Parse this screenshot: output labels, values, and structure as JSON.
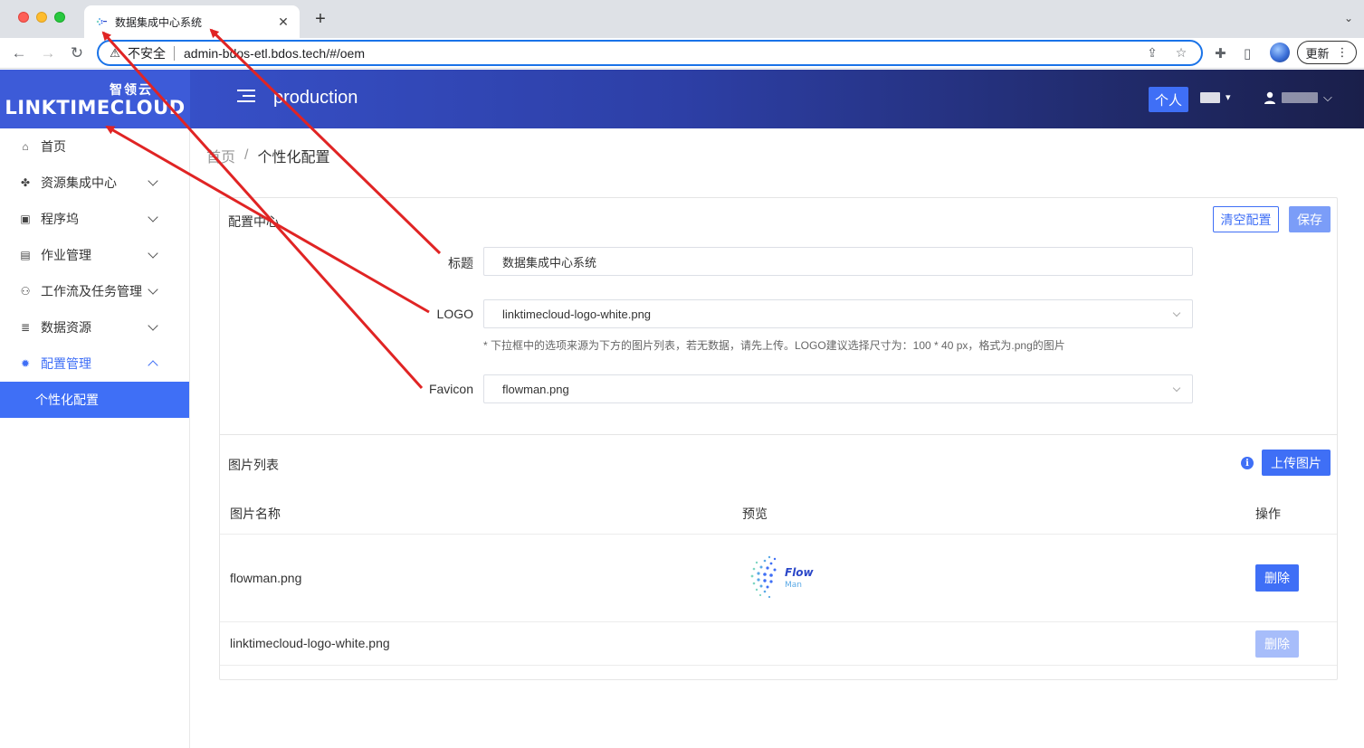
{
  "browser": {
    "tab_title": "数据集成中心系统",
    "tab_close": "✕",
    "new_tab": "+",
    "tab_menu": "⌄",
    "insecure_label": "不安全",
    "url": "admin-bdos-etl.bdos.tech/#/oem",
    "update_label": "更新",
    "update_menu": "⋮",
    "back": "←",
    "forward": "→",
    "reload": "↻",
    "warning": "⚠",
    "share": "⇪",
    "bookmark": "☆",
    "extensions": "✚",
    "sidepanel": "▯"
  },
  "header": {
    "logo_cn": "智领云",
    "logo_en": "LINKTIMECLOUD",
    "env_name": "production",
    "personal_label": "个人",
    "caret": "▾",
    "user_caret": "⌵",
    "user_icon": "👤"
  },
  "sidebar": {
    "items": [
      {
        "label": "首页",
        "icon": "⌂"
      },
      {
        "label": "资源集成中心",
        "icon": "✤"
      },
      {
        "label": "程序坞",
        "icon": "▣"
      },
      {
        "label": "作业管理",
        "icon": "▤"
      },
      {
        "label": "工作流及任务管理",
        "icon": "⚇"
      },
      {
        "label": "数据资源",
        "icon": "≣"
      },
      {
        "label": "配置管理",
        "icon": "✹"
      }
    ],
    "sub_active": "个性化配置"
  },
  "breadcrumb": {
    "home": "首页",
    "sep": "/",
    "current": "个性化配置"
  },
  "config": {
    "section_title": "配置中心",
    "clear_label": "清空配置",
    "save_label": "保存",
    "title_label": "标题",
    "title_value": "数据集成中心系统",
    "logo_label": "LOGO",
    "logo_value": "linktimecloud-logo-white.png",
    "hint": "* 下拉框中的选项来源为下方的图片列表，若无数据，请先上传。LOGO建议选择尺寸为：100 * 40 px，格式为.png的图片",
    "favicon_label": "Favicon",
    "favicon_value": "flowman.png"
  },
  "images": {
    "section_title": "图片列表",
    "info_icon": "i",
    "upload_label": "上传图片",
    "columns": [
      "图片名称",
      "预览",
      "操作"
    ],
    "rows": [
      {
        "name": "flowman.png",
        "preview_text_1": "Flow",
        "preview_text_2": "Man",
        "action": "删除"
      },
      {
        "name": "linktimecloud-logo-white.png",
        "action": "删除"
      }
    ]
  },
  "colors": {
    "primary": "#3f6ff6",
    "header_start": "#3a56d4",
    "header_end": "#1a1f4a",
    "annotation": "#e02424"
  }
}
